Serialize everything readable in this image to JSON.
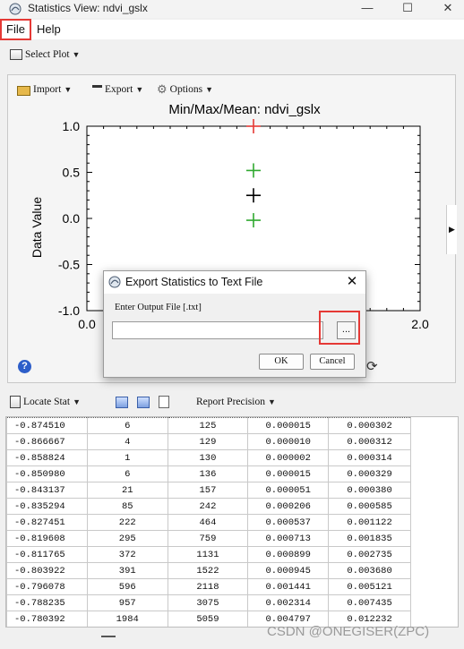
{
  "window": {
    "title": "Statistics View: ndvi_gslx",
    "minimize": "—",
    "maximize": "☐",
    "close": "✕"
  },
  "menu": {
    "file": "File",
    "help": "Help"
  },
  "toolbar": {
    "select_plot": "Select Plot"
  },
  "plot": {
    "import_label": "Import",
    "export_label": "Export",
    "options_label": "Options"
  },
  "chart_data": {
    "type": "scatter",
    "title": "Min/Max/Mean: ndvi_gslx",
    "ylabel": "Data Value",
    "xlabel": "",
    "xlim": [
      0.0,
      2.0
    ],
    "ylim": [
      -1.0,
      1.0
    ],
    "xticks": [
      "0.0",
      "2.0"
    ],
    "yticks": [
      "1.0",
      "0.5",
      "0.0",
      "-0.5",
      "-1.0"
    ],
    "marker": "+",
    "series": [
      {
        "color": "#e53935",
        "points": [
          {
            "x": 1.0,
            "y": 1.0
          }
        ]
      },
      {
        "color": "#2fa82f",
        "points": [
          {
            "x": 1.0,
            "y": 0.52
          },
          {
            "x": 1.0,
            "y": -0.02
          }
        ]
      },
      {
        "color": "#000000",
        "points": [
          {
            "x": 1.0,
            "y": 0.25
          }
        ]
      }
    ]
  },
  "dialog": {
    "title": "Export Statistics to Text File",
    "close": "✕",
    "label": "Enter Output File [.txt]",
    "input_value": "",
    "browse_label": "...",
    "ok_label": "OK",
    "cancel_label": "Cancel"
  },
  "stats_toolbar": {
    "locate_stat": "Locate Stat",
    "report_precision": "Report Precision"
  },
  "table": {
    "rows": [
      [
        "-0.874510",
        "6",
        "125",
        "0.000015",
        "0.000302"
      ],
      [
        "-0.866667",
        "4",
        "129",
        "0.000010",
        "0.000312"
      ],
      [
        "-0.858824",
        "1",
        "130",
        "0.000002",
        "0.000314"
      ],
      [
        "-0.850980",
        "6",
        "136",
        "0.000015",
        "0.000329"
      ],
      [
        "-0.843137",
        "21",
        "157",
        "0.000051",
        "0.000380"
      ],
      [
        "-0.835294",
        "85",
        "242",
        "0.000206",
        "0.000585"
      ],
      [
        "-0.827451",
        "222",
        "464",
        "0.000537",
        "0.001122"
      ],
      [
        "-0.819608",
        "295",
        "759",
        "0.000713",
        "0.001835"
      ],
      [
        "-0.811765",
        "372",
        "1131",
        "0.000899",
        "0.002735"
      ],
      [
        "-0.803922",
        "391",
        "1522",
        "0.000945",
        "0.003680"
      ],
      [
        "-0.796078",
        "596",
        "2118",
        "0.001441",
        "0.005121"
      ],
      [
        "-0.788235",
        "957",
        "3075",
        "0.002314",
        "0.007435"
      ],
      [
        "-0.780392",
        "1984",
        "5059",
        "0.004797",
        "0.012232"
      ]
    ]
  },
  "watermark": "CSDN @ONEGISER(ZPC)"
}
